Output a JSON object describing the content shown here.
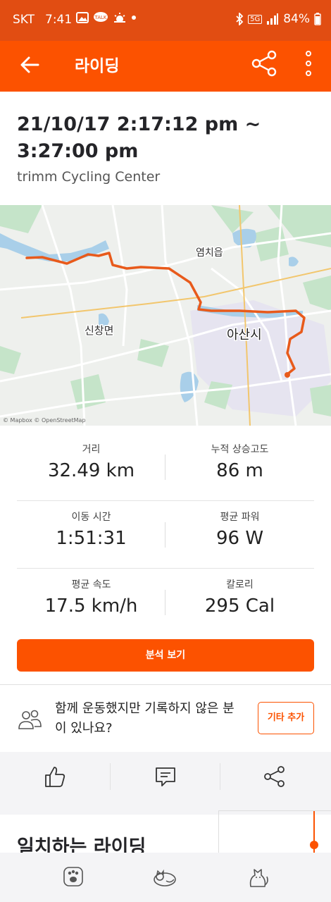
{
  "statusbar": {
    "carrier": "SKT",
    "time": "7:41",
    "network": "5G",
    "battery": "84%"
  },
  "appbar": {
    "title": "라이딩",
    "icons": [
      "back-arrow-icon",
      "share-icon",
      "more-vertical-icon"
    ]
  },
  "activity": {
    "datetime": "21/10/17 2:17:12 pm ~ 3:27:00 pm",
    "location": "trimm Cycling Center"
  },
  "map": {
    "labels": {
      "town1": "염치읍",
      "town2": "신창면",
      "city": "아산시"
    },
    "attribution": "© Mapbox © OpenStreetMap",
    "route_color": "#e85a1b"
  },
  "stats": {
    "distance": {
      "label": "거리",
      "value": "32.49 km"
    },
    "elevation": {
      "label": "누적 상승고도",
      "value": "86 m"
    },
    "moving_time": {
      "label": "이동 시간",
      "value": "1:51:31"
    },
    "avg_power": {
      "label": "평균 파워",
      "value": "96 W"
    },
    "avg_speed": {
      "label": "평균 속도",
      "value": "17.5 km/h"
    },
    "calories": {
      "label": "칼로리",
      "value": "295 Cal"
    }
  },
  "analysis_button": "분석 보기",
  "together": {
    "text": "함께 운동했지만 기록하지 않은 분이 있나요?",
    "button": "기타 추가"
  },
  "actions": [
    "thumbs-up-icon",
    "comment-icon",
    "share-icon"
  ],
  "matching": {
    "title": "일치하는 라이딩"
  },
  "bottom_nav": [
    "paw-icon",
    "sleeping-cat-icon",
    "cat-icon"
  ],
  "colors": {
    "accent": "#fc5200",
    "statusbar": "#e14d12"
  }
}
